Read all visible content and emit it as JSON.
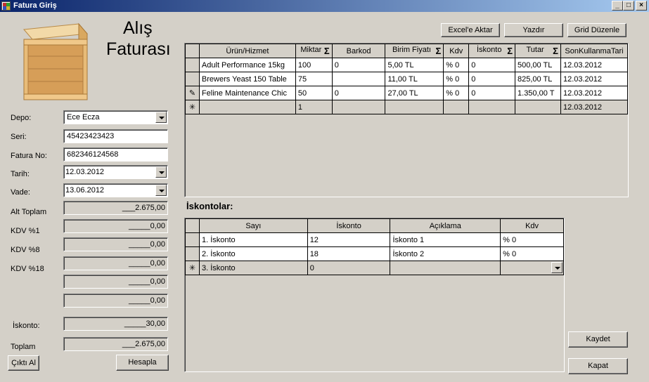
{
  "window": {
    "title": "Fatura Giriş"
  },
  "header": {
    "title_line1": "Alış",
    "title_line2": "Faturası"
  },
  "toolbar": {
    "excel": "Excel'e Aktar",
    "print": "Yazdır",
    "grid_edit": "Grid Düzenle"
  },
  "form": {
    "depo_label": "Depo:",
    "depo_value": "Ece Ecza",
    "seri_label": "Seri:",
    "seri_value": "45423423423",
    "fatura_no_label": "Fatura No:",
    "fatura_no_value": "682346124568",
    "tarih_label": "Tarih:",
    "tarih_value": "12.03.2012",
    "vade_label": "Vade:",
    "vade_value": "13.06.2012",
    "alt_toplam_label": "Alt Toplam",
    "alt_toplam_value": "___2.675,00",
    "kdv1_label": "KDV %1",
    "kdv1_value": "_____0,00",
    "kdv8_label": "KDV %8",
    "kdv8_value": "_____0,00",
    "kdv18_label": "KDV %18",
    "kdv18_value": "_____0,00",
    "extra1_value": "_____0,00",
    "extra2_value": "_____0,00",
    "iskonto_label": "İskonto:",
    "iskonto_value": "_____30,00",
    "toplam_label": "Toplam",
    "toplam_value": "___2.675,00"
  },
  "buttons": {
    "cikti": "Çıktı Al",
    "hesapla": "Hesapla",
    "kaydet": "Kaydet",
    "kapat": "Kapat"
  },
  "products": {
    "columns": [
      "Ürün/Hizmet",
      "Miktar",
      "Barkod",
      "Birim Fiyatı",
      "Kdv",
      "İskonto",
      "Tutar",
      "SonKullanmaTari"
    ],
    "rows": [
      {
        "indicator": "",
        "urun": "Adult Performance 15kg",
        "miktar": "100",
        "barkod": "0",
        "fiyat": "5,00 TL",
        "kdv": "% 0",
        "iskonto": "0",
        "tutar": "500,00 TL",
        "skt": "12.03.2012"
      },
      {
        "indicator": "",
        "urun": "Brewers Yeast 150 Table",
        "miktar": "75",
        "barkod": "",
        "fiyat": "11,00 TL",
        "kdv": "% 0",
        "iskonto": "0",
        "tutar": "825,00 TL",
        "skt": "12.03.2012"
      },
      {
        "indicator": "✎",
        "urun": "Feline Maintenance Chic",
        "miktar": "50",
        "barkod": "0",
        "fiyat": "27,00 TL",
        "kdv": "% 0",
        "iskonto": "0",
        "tutar": "1.350,00 T",
        "skt": "12.03.2012"
      },
      {
        "indicator": "✳",
        "urun": "",
        "miktar": "1",
        "barkod": "",
        "fiyat": "",
        "kdv": "",
        "iskonto": "",
        "tutar": "",
        "skt": "12.03.2012"
      }
    ]
  },
  "discounts": {
    "section_label": "İskontolar:",
    "columns": [
      "Sayı",
      "İskonto",
      "Açıklama",
      "Kdv"
    ],
    "rows": [
      {
        "indicator": "",
        "sayi": "1. İskonto",
        "iskonto": "12",
        "aciklama": "İskonto 1",
        "kdv": "% 0"
      },
      {
        "indicator": "",
        "sayi": "2. İskonto",
        "iskonto": "18",
        "aciklama": "İskonto 2",
        "kdv": "% 0"
      },
      {
        "indicator": "✳",
        "sayi": "3. İskonto",
        "iskonto": "0",
        "aciklama": "",
        "kdv": ""
      }
    ]
  }
}
